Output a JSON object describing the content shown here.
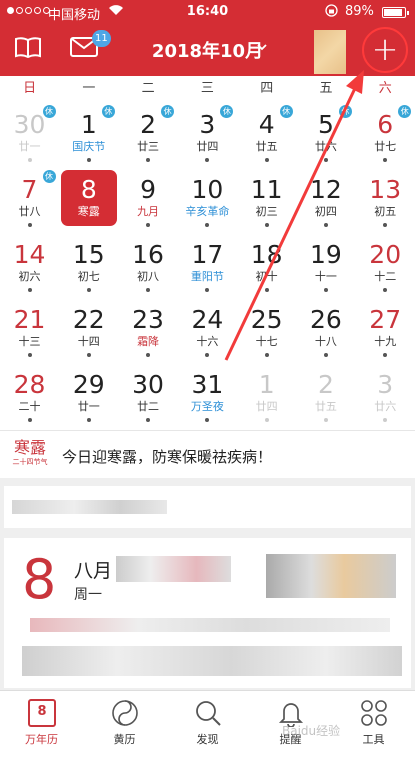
{
  "status_bar": {
    "carrier": "中国移动",
    "wifi": "wifi-icon",
    "time": "16:40",
    "lock": "rotation-lock-icon",
    "battery": "89%",
    "battery_level": 0.89
  },
  "header": {
    "menu_icon": "book-icon",
    "mail_icon": "mail-icon",
    "mail_badge": "11",
    "month_title": "2018年10月",
    "add_label": "+",
    "accent": "#d42d34"
  },
  "calendar": {
    "weekdays": [
      "日",
      "一",
      "二",
      "三",
      "四",
      "五",
      "六"
    ],
    "holiday_badge": "休",
    "days": [
      {
        "n": "30",
        "sub": "廿一",
        "faded": true,
        "badge": true
      },
      {
        "n": "1",
        "sub": "国庆节",
        "holiday": true,
        "badge": true
      },
      {
        "n": "2",
        "sub": "廿三",
        "badge": true
      },
      {
        "n": "3",
        "sub": "廿四",
        "badge": true
      },
      {
        "n": "4",
        "sub": "廿五",
        "badge": true
      },
      {
        "n": "5",
        "sub": "廿六",
        "badge": true
      },
      {
        "n": "6",
        "sub": "廿七",
        "badge": true
      },
      {
        "n": "7",
        "sub": "廿八",
        "badge": true
      },
      {
        "n": "8",
        "sub": "寒露",
        "selected": true
      },
      {
        "n": "9",
        "sub": "九月",
        "term": true
      },
      {
        "n": "10",
        "sub": "辛亥革命",
        "holiday": true
      },
      {
        "n": "11",
        "sub": "初三"
      },
      {
        "n": "12",
        "sub": "初四"
      },
      {
        "n": "13",
        "sub": "初五"
      },
      {
        "n": "14",
        "sub": "初六"
      },
      {
        "n": "15",
        "sub": "初七"
      },
      {
        "n": "16",
        "sub": "初八"
      },
      {
        "n": "17",
        "sub": "重阳节",
        "holiday": true
      },
      {
        "n": "18",
        "sub": "初十"
      },
      {
        "n": "19",
        "sub": "十一"
      },
      {
        "n": "20",
        "sub": "十二"
      },
      {
        "n": "21",
        "sub": "十三"
      },
      {
        "n": "22",
        "sub": "十四"
      },
      {
        "n": "23",
        "sub": "霜降",
        "term": true
      },
      {
        "n": "24",
        "sub": "十六"
      },
      {
        "n": "25",
        "sub": "十七"
      },
      {
        "n": "26",
        "sub": "十八"
      },
      {
        "n": "27",
        "sub": "十九"
      },
      {
        "n": "28",
        "sub": "二十"
      },
      {
        "n": "29",
        "sub": "廿一"
      },
      {
        "n": "30",
        "sub": "廿二"
      },
      {
        "n": "31",
        "sub": "万圣夜",
        "holiday": true
      },
      {
        "n": "1",
        "sub": "廿四",
        "faded": true
      },
      {
        "n": "2",
        "sub": "廿五",
        "faded": true
      },
      {
        "n": "3",
        "sub": "廿六",
        "faded": true
      }
    ]
  },
  "solar_term": {
    "logo_main": "寒露",
    "logo_sub": "二十四节气",
    "message": "今日迎寒露，防寒保暖祛疾病！"
  },
  "today_card": {
    "day": "8",
    "lunar_prefix": "八月",
    "weekday": "周一"
  },
  "bottom_nav": {
    "items": [
      {
        "label": "万年历",
        "icon": "calendar-icon",
        "icon_text": "8"
      },
      {
        "label": "黄历",
        "icon": "yin-yang-icon"
      },
      {
        "label": "发现",
        "icon": "search-icon"
      },
      {
        "label": "提醒",
        "icon": "bell-icon"
      },
      {
        "label": "工具",
        "icon": "grid-icon"
      }
    ]
  },
  "watermark": "Baidu经验"
}
